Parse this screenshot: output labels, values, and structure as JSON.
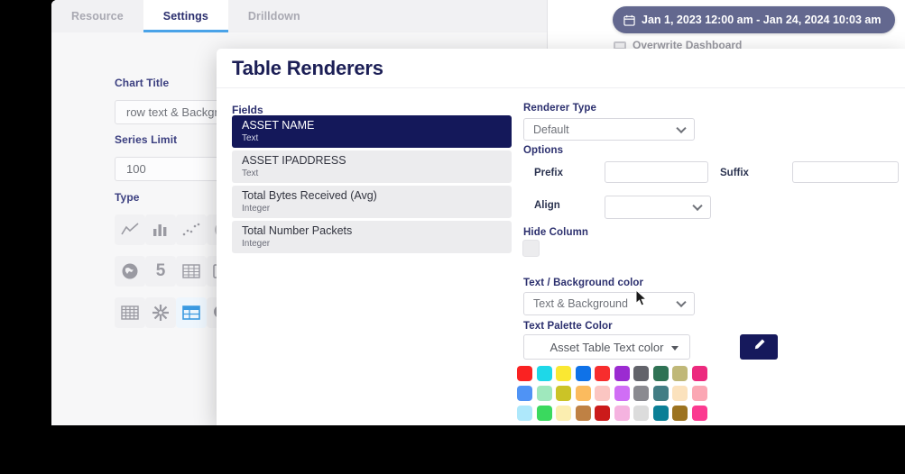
{
  "background": {
    "tabs": [
      {
        "label": "Resource",
        "active": false
      },
      {
        "label": "Settings",
        "active": true
      },
      {
        "label": "Drilldown",
        "active": false
      }
    ],
    "chart_title": {
      "label": "Chart Title",
      "value": "row text & Background color"
    },
    "series_limit": {
      "label": "Series Limit",
      "value": "100"
    },
    "type": {
      "label": "Type",
      "icons": [
        {
          "name": "line-chart-icon",
          "selected": false
        },
        {
          "name": "bar-chart-icon",
          "selected": false
        },
        {
          "name": "scatter-chart-icon",
          "selected": false
        },
        {
          "name": "pie-chart-icon",
          "selected": false
        },
        {
          "name": "funnel-chart-icon",
          "selected": false
        },
        {
          "name": "globe-map-icon",
          "selected": false
        },
        {
          "name": "single-value-icon",
          "selected": false
        },
        {
          "name": "data-table-icon",
          "selected": false
        },
        {
          "name": "panel-table-icon",
          "selected": false
        },
        {
          "name": "sankey-chart-icon",
          "selected": false
        },
        {
          "name": "grid-icon",
          "selected": false
        },
        {
          "name": "radial-sunburst-icon",
          "selected": false
        },
        {
          "name": "table-renderer-icon",
          "selected": true
        },
        {
          "name": "pie-bar-combo-icon",
          "selected": false
        }
      ]
    },
    "date_range": "Jan 1, 2023 12:00 am - Jan 24, 2024 10:03 am",
    "overwrite_dashboard": "Overwrite Dashboard"
  },
  "modal": {
    "title": "Table Renderers",
    "fields_header": "Fields",
    "fields": [
      {
        "name": "ASSET NAME",
        "type": "Text",
        "active": true
      },
      {
        "name": "ASSET IPADDRESS",
        "type": "Text",
        "active": false
      },
      {
        "name": "Total Bytes Received (Avg)",
        "type": "Integer",
        "active": false
      },
      {
        "name": "Total Number Packets",
        "type": "Integer",
        "active": false
      }
    ],
    "renderer_type": {
      "label": "Renderer Type",
      "value": "Default"
    },
    "options": {
      "label": "Options",
      "prefix": {
        "label": "Prefix",
        "value": ""
      },
      "suffix": {
        "label": "Suffix",
        "value": ""
      },
      "align": {
        "label": "Align",
        "value": ""
      }
    },
    "hide_column": {
      "label": "Hide Column",
      "checked": false
    },
    "text_background_color": {
      "label": "Text / Background color",
      "value": "Text & Background"
    },
    "text_palette_color": {
      "label": "Text Palette Color",
      "value": "Asset Table Text color"
    },
    "edit_button_color": "#16195c",
    "palette": [
      "#fa2222",
      "#1ed8e8",
      "#fae832",
      "#0f72e8",
      "#f72d2d",
      "#9b2bd1",
      "#62636a",
      "#2f7254",
      "#c0b878",
      "#ec2a7e",
      "#4f93f5",
      "#9fe8bd",
      "#cbc327",
      "#fbbb5e",
      "#fbc6c2",
      "#d06ef5",
      "#8a8a90",
      "#427d84",
      "#fbe2bd",
      "#fba7b4",
      "#aee8fb",
      "#3ad95e",
      "#fbeeb0",
      "#bf8144",
      "#cb1a1a",
      "#f5b3e0",
      "#dcdcdc",
      "#0a7f96",
      "#9c7320",
      "#fb3a90"
    ]
  }
}
